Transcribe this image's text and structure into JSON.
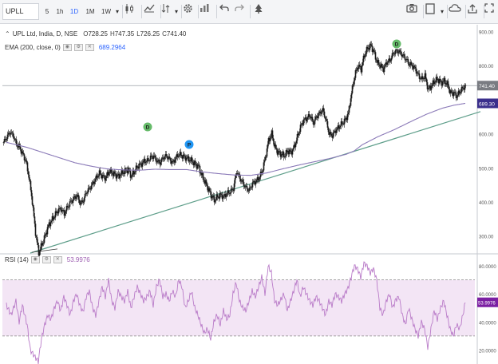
{
  "toolbar": {
    "symbol": "UPLL",
    "intervals": [
      "5",
      "1h",
      "1D",
      "1M",
      "1W"
    ],
    "active_interval": "1D"
  },
  "legend": {
    "title": "UPL Ltd, India, D, NSE",
    "open_label": "O",
    "open": "728.25",
    "high_label": "H",
    "high": "747.35",
    "low_label": "L",
    "low": "726.25",
    "close_label": "C",
    "close": "741.40",
    "ema_label": "EMA (200, close, 0)",
    "ema_value": "689.2964",
    "rsi_label": "RSI (14)",
    "rsi_value": "53.9976"
  },
  "price_axis": {
    "ticks": [
      "900.00",
      "800.00",
      "700.00",
      "600.00",
      "500.00",
      "400.00",
      "300.00"
    ],
    "current_price_label": "741.40",
    "ema_label": "689.30"
  },
  "rsi_axis": {
    "ticks": [
      "80.0000",
      "60.0000",
      "40.0000",
      "20.0000"
    ],
    "current_label": "53.9976"
  },
  "markers": [
    {
      "letter": "D",
      "type": "dividend"
    },
    {
      "letter": "P",
      "type": "split"
    },
    {
      "letter": "D",
      "type": "dividend"
    }
  ],
  "colors": {
    "up": "#26a69a",
    "down": "#ef5350",
    "ema": "#8b7ab8",
    "trendline": "#5e9e8a",
    "rsi_line": "#b97bc8",
    "rsi_band": "#f3e5f5",
    "price_label": "#7a7c82",
    "ema_label": "#3b2f8c",
    "rsi_label": "#7b1fa2",
    "dividend": "#66bb6a",
    "split": "#2196f3"
  },
  "chart_data": {
    "type": "candlestick",
    "price_ylim": [
      250,
      920
    ],
    "rsi_ylim": [
      10,
      88
    ],
    "rsi_bands": [
      70,
      30
    ],
    "price_anchors": [
      [
        0,
        575
      ],
      [
        4,
        590
      ],
      [
        8,
        605
      ],
      [
        12,
        595
      ],
      [
        16,
        570
      ],
      [
        20,
        560
      ],
      [
        24,
        540
      ],
      [
        28,
        520
      ],
      [
        32,
        470
      ],
      [
        36,
        400
      ],
      [
        40,
        310
      ],
      [
        44,
        250
      ],
      [
        48,
        275
      ],
      [
        52,
        300
      ],
      [
        56,
        330
      ],
      [
        60,
        345
      ],
      [
        64,
        360
      ],
      [
        68,
        375
      ],
      [
        72,
        380
      ],
      [
        76,
        365
      ],
      [
        80,
        385
      ],
      [
        84,
        400
      ],
      [
        88,
        410
      ],
      [
        92,
        420
      ],
      [
        96,
        395
      ],
      [
        100,
        405
      ],
      [
        104,
        430
      ],
      [
        108,
        440
      ],
      [
        112,
        455
      ],
      [
        116,
        470
      ],
      [
        120,
        485
      ],
      [
        124,
        475
      ],
      [
        128,
        470
      ],
      [
        132,
        490
      ],
      [
        136,
        485
      ],
      [
        140,
        480
      ],
      [
        144,
        475
      ],
      [
        148,
        485
      ],
      [
        152,
        490
      ],
      [
        156,
        495
      ],
      [
        160,
        475
      ],
      [
        164,
        490
      ],
      [
        168,
        505
      ],
      [
        172,
        510
      ],
      [
        176,
        520
      ],
      [
        180,
        520
      ],
      [
        184,
        530
      ],
      [
        188,
        535
      ],
      [
        192,
        520
      ],
      [
        196,
        515
      ],
      [
        200,
        530
      ],
      [
        204,
        535
      ],
      [
        208,
        525
      ],
      [
        212,
        515
      ],
      [
        216,
        530
      ],
      [
        220,
        540
      ],
      [
        224,
        535
      ],
      [
        228,
        530
      ],
      [
        232,
        525
      ],
      [
        236,
        520
      ],
      [
        240,
        510
      ],
      [
        244,
        505
      ],
      [
        248,
        480
      ],
      [
        252,
        460
      ],
      [
        256,
        440
      ],
      [
        260,
        420
      ],
      [
        264,
        405
      ],
      [
        268,
        415
      ],
      [
        272,
        420
      ],
      [
        276,
        415
      ],
      [
        280,
        425
      ],
      [
        284,
        430
      ],
      [
        288,
        440
      ],
      [
        292,
        490
      ],
      [
        296,
        470
      ],
      [
        300,
        455
      ],
      [
        304,
        440
      ],
      [
        308,
        435
      ],
      [
        312,
        455
      ],
      [
        316,
        460
      ],
      [
        320,
        470
      ],
      [
        324,
        490
      ],
      [
        328,
        530
      ],
      [
        332,
        580
      ],
      [
        336,
        600
      ],
      [
        340,
        560
      ],
      [
        344,
        545
      ],
      [
        348,
        540
      ],
      [
        352,
        535
      ],
      [
        356,
        550
      ],
      [
        360,
        545
      ],
      [
        364,
        560
      ],
      [
        368,
        590
      ],
      [
        372,
        620
      ],
      [
        376,
        640
      ],
      [
        380,
        645
      ],
      [
        384,
        655
      ],
      [
        388,
        630
      ],
      [
        392,
        650
      ],
      [
        396,
        660
      ],
      [
        400,
        670
      ],
      [
        404,
        640
      ],
      [
        408,
        600
      ],
      [
        412,
        595
      ],
      [
        416,
        610
      ],
      [
        420,
        620
      ],
      [
        424,
        630
      ],
      [
        428,
        640
      ],
      [
        432,
        660
      ],
      [
        436,
        720
      ],
      [
        440,
        770
      ],
      [
        444,
        800
      ],
      [
        448,
        790
      ],
      [
        452,
        830
      ],
      [
        456,
        850
      ],
      [
        460,
        860
      ],
      [
        464,
        840
      ],
      [
        468,
        810
      ],
      [
        472,
        800
      ],
      [
        476,
        790
      ],
      [
        480,
        810
      ],
      [
        484,
        815
      ],
      [
        488,
        835
      ],
      [
        492,
        845
      ],
      [
        496,
        840
      ],
      [
        500,
        830
      ],
      [
        504,
        820
      ],
      [
        508,
        805
      ],
      [
        512,
        800
      ],
      [
        516,
        790
      ],
      [
        520,
        770
      ],
      [
        524,
        760
      ],
      [
        528,
        770
      ],
      [
        532,
        730
      ],
      [
        536,
        740
      ],
      [
        540,
        755
      ],
      [
        544,
        760
      ],
      [
        548,
        750
      ],
      [
        552,
        755
      ],
      [
        556,
        745
      ],
      [
        560,
        720
      ],
      [
        564,
        720
      ],
      [
        568,
        710
      ],
      [
        572,
        725
      ],
      [
        576,
        735
      ],
      [
        579,
        741.4
      ]
    ],
    "ema_anchors": [
      [
        4,
        575
      ],
      [
        30,
        560
      ],
      [
        50,
        545
      ],
      [
        70,
        530
      ],
      [
        90,
        515
      ],
      [
        110,
        505
      ],
      [
        130,
        497
      ],
      [
        150,
        494
      ],
      [
        170,
        493
      ],
      [
        190,
        496
      ],
      [
        210,
        495
      ],
      [
        230,
        495
      ],
      [
        250,
        488
      ],
      [
        270,
        483
      ],
      [
        290,
        479
      ],
      [
        310,
        478
      ],
      [
        330,
        485
      ],
      [
        350,
        497
      ],
      [
        370,
        508
      ],
      [
        390,
        518
      ],
      [
        410,
        528
      ],
      [
        430,
        540
      ],
      [
        440,
        550
      ],
      [
        450,
        568
      ],
      [
        470,
        592
      ],
      [
        490,
        612
      ],
      [
        510,
        635
      ],
      [
        530,
        657
      ],
      [
        550,
        675
      ],
      [
        565,
        684
      ],
      [
        579,
        689.3
      ]
    ],
    "trendline": [
      [
        34,
        250
      ],
      [
        598,
        665
      ]
    ],
    "trendline_arrow": [
      [
        36,
        252
      ],
      [
        68,
        262
      ]
    ],
    "horizontal_line": 741.4,
    "rsi_anchors": [
      [
        4,
        52
      ],
      [
        10,
        45
      ],
      [
        16,
        55
      ],
      [
        20,
        40
      ],
      [
        24,
        52
      ],
      [
        30,
        38
      ],
      [
        34,
        20
      ],
      [
        40,
        15
      ],
      [
        44,
        12
      ],
      [
        48,
        28
      ],
      [
        52,
        38
      ],
      [
        56,
        45
      ],
      [
        60,
        42
      ],
      [
        64,
        50
      ],
      [
        68,
        55
      ],
      [
        72,
        48
      ],
      [
        76,
        58
      ],
      [
        80,
        52
      ],
      [
        84,
        45
      ],
      [
        88,
        55
      ],
      [
        92,
        60
      ],
      [
        96,
        52
      ],
      [
        100,
        47
      ],
      [
        104,
        58
      ],
      [
        108,
        62
      ],
      [
        112,
        50
      ],
      [
        116,
        45
      ],
      [
        120,
        55
      ],
      [
        124,
        65
      ],
      [
        128,
        58
      ],
      [
        132,
        70
      ],
      [
        136,
        55
      ],
      [
        140,
        50
      ],
      [
        144,
        62
      ],
      [
        148,
        58
      ],
      [
        152,
        55
      ],
      [
        156,
        62
      ],
      [
        160,
        50
      ],
      [
        164,
        58
      ],
      [
        168,
        65
      ],
      [
        172,
        60
      ],
      [
        176,
        55
      ],
      [
        180,
        58
      ],
      [
        184,
        62
      ],
      [
        188,
        52
      ],
      [
        192,
        65
      ],
      [
        196,
        70
      ],
      [
        200,
        58
      ],
      [
        204,
        60
      ],
      [
        208,
        55
      ],
      [
        212,
        62
      ],
      [
        216,
        58
      ],
      [
        220,
        70
      ],
      [
        224,
        65
      ],
      [
        228,
        50
      ],
      [
        232,
        55
      ],
      [
        236,
        62
      ],
      [
        240,
        50
      ],
      [
        244,
        45
      ],
      [
        248,
        38
      ],
      [
        252,
        32
      ],
      [
        256,
        35
      ],
      [
        260,
        28
      ],
      [
        264,
        40
      ],
      [
        268,
        45
      ],
      [
        272,
        38
      ],
      [
        276,
        48
      ],
      [
        280,
        42
      ],
      [
        284,
        45
      ],
      [
        288,
        60
      ],
      [
        292,
        68
      ],
      [
        296,
        55
      ],
      [
        300,
        50
      ],
      [
        304,
        48
      ],
      [
        308,
        55
      ],
      [
        312,
        62
      ],
      [
        316,
        58
      ],
      [
        320,
        65
      ],
      [
        324,
        72
      ],
      [
        328,
        60
      ],
      [
        332,
        80
      ],
      [
        336,
        75
      ],
      [
        340,
        55
      ],
      [
        344,
        52
      ],
      [
        348,
        56
      ],
      [
        352,
        60
      ],
      [
        356,
        48
      ],
      [
        360,
        55
      ],
      [
        364,
        62
      ],
      [
        368,
        70
      ],
      [
        372,
        58
      ],
      [
        376,
        65
      ],
      [
        380,
        60
      ],
      [
        384,
        55
      ],
      [
        388,
        52
      ],
      [
        392,
        58
      ],
      [
        396,
        55
      ],
      [
        400,
        50
      ],
      [
        404,
        45
      ],
      [
        408,
        55
      ],
      [
        412,
        52
      ],
      [
        416,
        60
      ],
      [
        420,
        58
      ],
      [
        424,
        55
      ],
      [
        428,
        60
      ],
      [
        432,
        64
      ],
      [
        436,
        72
      ],
      [
        440,
        80
      ],
      [
        444,
        78
      ],
      [
        448,
        72
      ],
      [
        452,
        82
      ],
      [
        456,
        80
      ],
      [
        460,
        75
      ],
      [
        464,
        78
      ],
      [
        468,
        70
      ],
      [
        472,
        50
      ],
      [
        476,
        45
      ],
      [
        480,
        55
      ],
      [
        484,
        60
      ],
      [
        488,
        50
      ],
      [
        492,
        56
      ],
      [
        496,
        58
      ],
      [
        500,
        45
      ],
      [
        504,
        38
      ],
      [
        508,
        50
      ],
      [
        512,
        42
      ],
      [
        516,
        35
      ],
      [
        520,
        30
      ],
      [
        524,
        40
      ],
      [
        528,
        35
      ],
      [
        532,
        22
      ],
      [
        536,
        35
      ],
      [
        540,
        48
      ],
      [
        544,
        42
      ],
      [
        548,
        50
      ],
      [
        552,
        55
      ],
      [
        556,
        45
      ],
      [
        560,
        35
      ],
      [
        564,
        30
      ],
      [
        568,
        38
      ],
      [
        572,
        35
      ],
      [
        576,
        45
      ],
      [
        579,
        54
      ]
    ]
  }
}
